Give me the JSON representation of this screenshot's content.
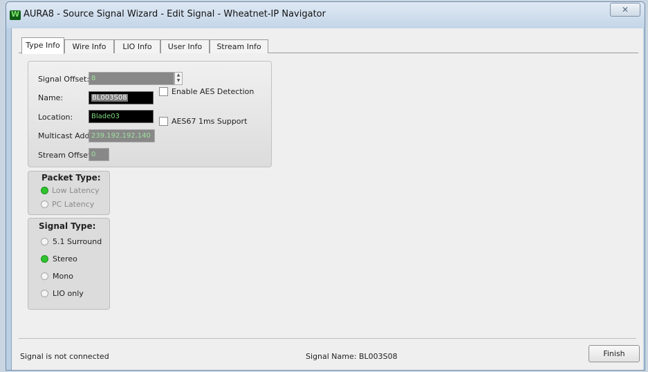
{
  "window": {
    "title": "AURA8 - Source Signal Wizard - Edit Signal - Wheatnet-IP Navigator",
    "close_glyph": "✕"
  },
  "tabs": [
    {
      "label": "Type Info",
      "active": true
    },
    {
      "label": "Wire Info",
      "active": false
    },
    {
      "label": "LIO Info",
      "active": false
    },
    {
      "label": "User Info",
      "active": false
    },
    {
      "label": "Stream Info",
      "active": false
    }
  ],
  "type_info": {
    "signal_offset_label": "Signal Offset:",
    "signal_offset_value": "8",
    "name_label": "Name:",
    "name_value": "BL003S08",
    "location_label": "Location:",
    "location_value": "Blade03",
    "multicast_label": "Multicast Addr:",
    "multicast_value": "239.192.192.140",
    "stream_offset_label": "Stream Offset:",
    "stream_offset_value": "0",
    "enable_aes_label": "Enable AES Detection",
    "enable_aes_checked": false,
    "aes67_label": "AES67 1ms Support",
    "aes67_checked": false
  },
  "packet_type": {
    "title": "Packet Type:",
    "options": [
      {
        "label": "Low Latency",
        "selected": true
      },
      {
        "label": "PC Latency",
        "selected": false
      }
    ]
  },
  "signal_type": {
    "title": "Signal Type:",
    "options": [
      {
        "label": "5.1 Surround",
        "selected": false
      },
      {
        "label": "Stereo",
        "selected": true
      },
      {
        "label": "Mono",
        "selected": false
      },
      {
        "label": "LIO only",
        "selected": false
      }
    ]
  },
  "status_bar": {
    "connection_status": "Signal is not connected",
    "signal_name": "Signal Name:  BL003S08"
  },
  "finish_label": "Finish",
  "colors": {
    "field_text_green": "#7ed97e",
    "radio_selected_green": "#2ec42e"
  }
}
